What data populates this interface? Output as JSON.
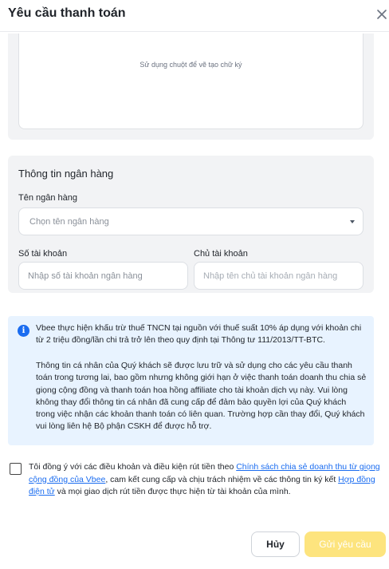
{
  "dialog": {
    "title": "Yêu cầu thanh toán",
    "close_icon": "close-icon"
  },
  "signature": {
    "hint": "Sử dụng chuột để vẽ tạo chữ ký"
  },
  "bank": {
    "section_title": "Thông tin ngân hàng",
    "bank_name_label": "Tên ngân hàng",
    "bank_name_placeholder": "Chọn tên ngân hàng",
    "account_number_label": "Số tài khoản",
    "account_number_placeholder": "Nhập số tài khoản ngân hàng",
    "account_holder_label": "Chủ tài khoản",
    "account_holder_placeholder": "Nhập tên chủ tài khoản ngân hàng"
  },
  "notice": {
    "icon": "info-icon",
    "paragraph1": "Vbee thực hiện khấu trừ thuế TNCN tại nguồn với thuế suất 10% áp dụng với khoản chi từ 2 triệu đồng/lần chi trả trở lên theo quy định tại Thông tư 111/2013/TT-BTC.",
    "paragraph2": "Thông tin cá nhân của Quý khách sẽ được lưu trữ và sử dụng cho các yêu cầu thanh toán trong tương lai, bao gồm nhưng không giới hạn ở việc thanh toán doanh thu chia sẻ giọng cộng đồng và thanh toán hoa hồng affiliate cho tài khoản dịch vụ này. Vui lòng không thay đổi thông tin cá nhân đã cung cấp để đảm bảo quyền lợi của Quý khách trong việc nhận các khoản thanh toán có liên quan. Trường hợp cần thay đổi, Quý khách vui lòng liên hệ Bộ phận CSKH để được hỗ trợ."
  },
  "consent": {
    "text_part1": "Tôi đồng ý với các điều khoản và điều kiện rút tiền theo ",
    "policy_link": "Chính sách chia sẻ doanh thu từ giọng cộng đồng của Vbee",
    "text_part2": ", cam kết cung cấp và chịu trách nhiệm về các thông tin ký kết ",
    "contract_link": "Hợp đồng điện tử",
    "text_part3": " và mọi giao dịch rút tiền được thực hiện từ tài khoản của mình.",
    "checked": false
  },
  "actions": {
    "cancel_label": "Hủy",
    "submit_label": "Gửi yêu cầu"
  },
  "colors": {
    "accent_blue": "#1a6cf0",
    "submit_disabled": "#fde47e",
    "info_bg": "#e8f3ff",
    "card_bg": "#f2f3f5"
  }
}
